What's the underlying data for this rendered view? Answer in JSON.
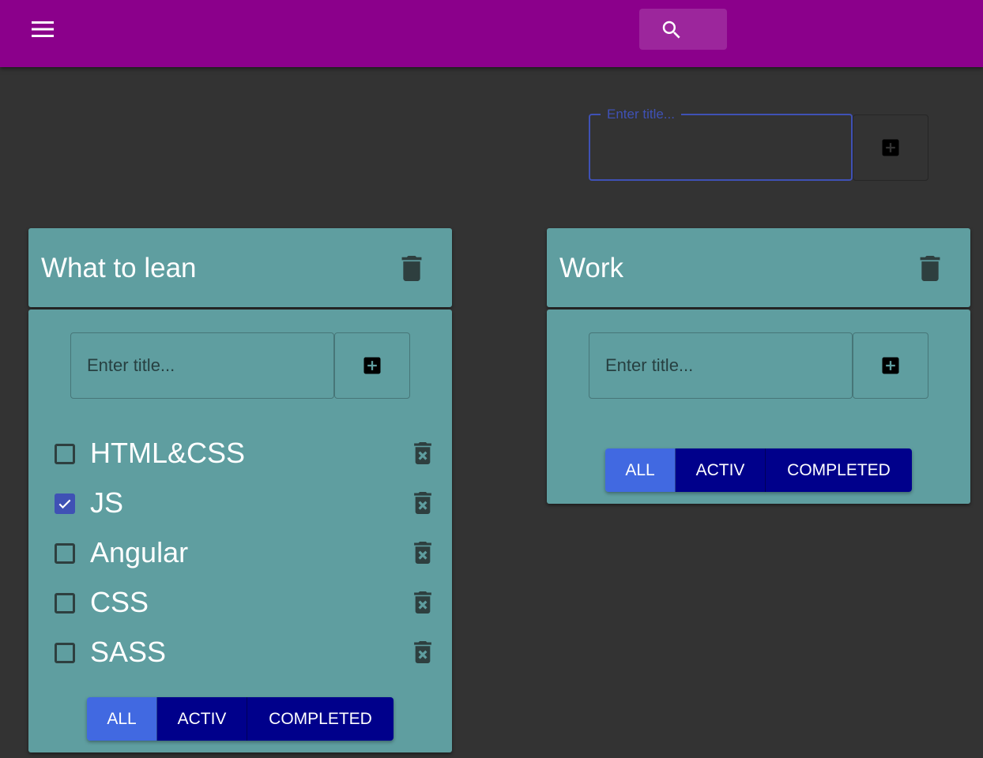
{
  "header": {
    "menu_icon": "menu-icon",
    "search_icon": "search-icon",
    "bar_color": "#8b008b"
  },
  "new_list": {
    "label": "Enter title..."
  },
  "lists": [
    {
      "title": "What to lean",
      "input_placeholder": "Enter title...",
      "tasks": [
        {
          "label": "HTML&CSS",
          "done": false
        },
        {
          "label": "JS",
          "done": true
        },
        {
          "label": "Angular",
          "done": false
        },
        {
          "label": "CSS",
          "done": false
        },
        {
          "label": "SASS",
          "done": false
        }
      ],
      "filters": [
        "ALL",
        "ACTIV",
        "COMPLETED"
      ],
      "active_filter": "ALL"
    },
    {
      "title": "Work",
      "input_placeholder": "Enter title...",
      "tasks": [],
      "filters": [
        "ALL",
        "ACTIV",
        "COMPLETED"
      ],
      "active_filter": "ALL"
    }
  ],
  "colors": {
    "card": "#5f9ea0",
    "filter_active": "#4169e1",
    "filter_inactive": "#00008b",
    "focus": "#3f51b5"
  }
}
